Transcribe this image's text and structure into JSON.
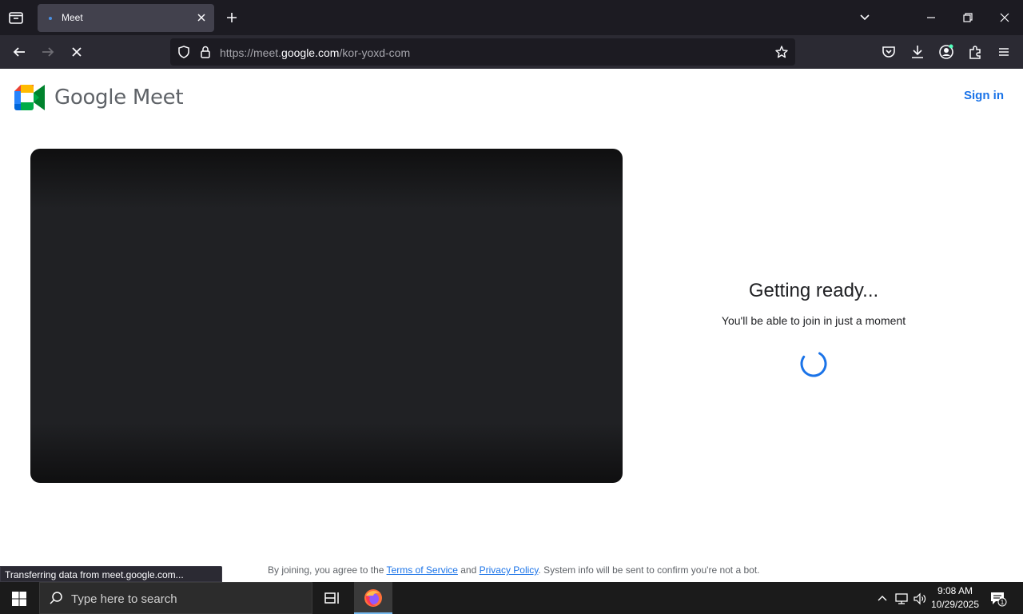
{
  "browser": {
    "tab": {
      "title": "Meet"
    },
    "url": {
      "prefix": "https://meet.",
      "domain": "google.com",
      "path": "/kor-yoxd-com"
    }
  },
  "meet": {
    "brand": "Google Meet",
    "sign_in": "Sign in",
    "status_title": "Getting ready...",
    "status_subtitle": "You'll be able to join in just a moment",
    "footer": {
      "prefix": "By joining, you agree to the ",
      "terms": "Terms of Service",
      "and": " and ",
      "privacy": "Privacy Policy",
      "suffix": ". System info will be sent to confirm you're not a bot."
    },
    "colors": {
      "accent": "#1a73e8",
      "green": "#00832d",
      "yellow": "#ffba00",
      "red": "#ea4335",
      "blue": "#2684fc"
    }
  },
  "status_bar": {
    "text": "Transferring data from meet.google.com..."
  },
  "taskbar": {
    "search_placeholder": "Type here to search",
    "time": "9:08 AM",
    "date": "10/29/2025",
    "notification_count": "1"
  }
}
